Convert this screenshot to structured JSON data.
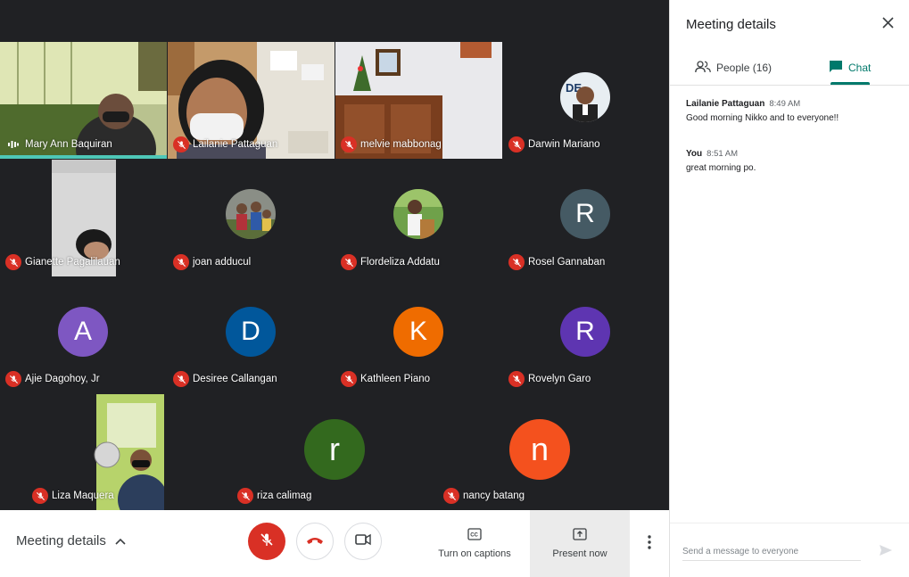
{
  "participants": [
    {
      "name": "Mary Ann Baquiran",
      "muted": false,
      "speaking": true
    },
    {
      "name": "Lailanie Pattaguan",
      "muted": true
    },
    {
      "name": "melvie mabbonag",
      "muted": true
    },
    {
      "name": "Darwin Mariano",
      "muted": true
    },
    {
      "name": "Gianette Pagalilauan",
      "muted": true
    },
    {
      "name": "joan adducul",
      "muted": true
    },
    {
      "name": "Flordeliza Addatu",
      "muted": true
    },
    {
      "name": "Rosel Gannaban",
      "muted": true,
      "initial": "R",
      "color": "#455a64"
    },
    {
      "name": "Ajie Dagohoy, Jr",
      "muted": true,
      "initial": "A",
      "color": "#7e57c2"
    },
    {
      "name": "Desiree Callangan",
      "muted": true,
      "initial": "D",
      "color": "#01579b"
    },
    {
      "name": "Kathleen Piano",
      "muted": true,
      "initial": "K",
      "color": "#ef6c00"
    },
    {
      "name": "Rovelyn Garo",
      "muted": true,
      "initial": "R",
      "color": "#5e35b1"
    },
    {
      "name": "Liza Maquera",
      "muted": true
    },
    {
      "name": "riza calimag",
      "muted": true,
      "initial": "r",
      "color": "#33691e"
    },
    {
      "name": "nancy batang",
      "muted": true,
      "initial": "n",
      "color": "#f4511e"
    }
  ],
  "bottombar": {
    "meeting_details_label": "Meeting details",
    "captions_label": "Turn on captions",
    "present_label": "Present now"
  },
  "panel": {
    "title": "Meeting details",
    "tabs": {
      "people_label": "People (16)",
      "chat_label": "Chat"
    },
    "messages": [
      {
        "sender": "Lailanie Pattaguan",
        "time": "8:49 AM",
        "text": "Good morning Nikko and to everyone!!"
      },
      {
        "sender": "You",
        "time": "8:51 AM",
        "text": "great morning po."
      }
    ],
    "composer_placeholder": "Send a message to everyone"
  },
  "colors": {
    "accent": "#00796b",
    "mute_red": "#d93025",
    "speaking_bar": "#4ec7b7"
  }
}
